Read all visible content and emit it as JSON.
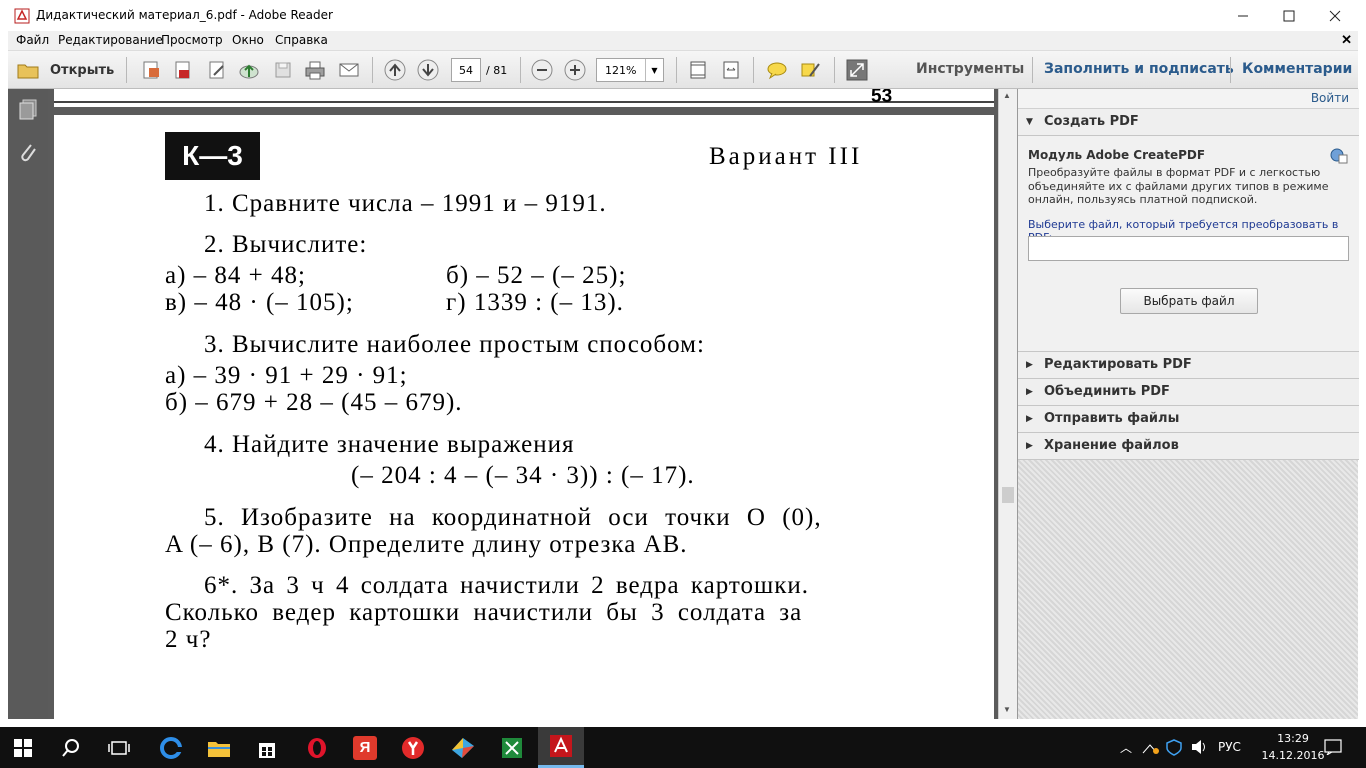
{
  "window": {
    "title": "Дидактический материал_6.pdf - Adobe Reader"
  },
  "menu": [
    "Файл",
    "Редактирование",
    "Просмотр",
    "Окно",
    "Справка"
  ],
  "toolbar": {
    "open": "Открыть",
    "page_current": "54",
    "page_total": "/ 81",
    "zoom": "121%",
    "tools": "Инструменты",
    "fill_sign": "Заполнить и подписать",
    "comments": "Комментарии"
  },
  "page": {
    "page_number": "53",
    "badge": "К—3",
    "variant": "Вариант III",
    "p1": "1. Сравните числа – 1991 и – 9191.",
    "p2": "2. Вычислите:",
    "p2a": "а)  – 84 + 48;",
    "p2b": "б)  – 52 – (– 25);",
    "p2c": "в)  – 48 · (– 105);",
    "p2d": "г)  1339 : (– 13).",
    "p3": "3. Вычислите наиболее простым способом:",
    "p3a": "а)  – 39 · 91 + 29 · 91;",
    "p3b": "б)  – 679 + 28 – (45 – 679).",
    "p4": "4. Найдите значение выражения",
    "p4e": "(– 204 : 4 – (– 34 · 3)) : (– 17).",
    "p5l1": "5. Изобразите на координатной оси точки O (0),",
    "p5l2": "A (– 6), B (7). Определите длину отрезка AB.",
    "p6l1": "6*. За 3 ч 4 солдата начистили 2 ведра картошки.",
    "p6l2": "Сколько ведер картошки начистили бы 3 солдата за",
    "p6l3": "2 ч?"
  },
  "rightpane": {
    "signin": "Войти",
    "create_pdf": "Создать PDF",
    "module_title": "Модуль Adobe CreatePDF",
    "module_desc": "Преобразуйте файлы в формат PDF и с легкостью объединяйте их с файлами других типов в режиме онлайн, пользуясь платной подпиской.",
    "select_label": "Выберите файл, который требуется преобразовать в PDF:",
    "choose_button": "Выбрать файл",
    "edit_pdf": "Редактировать PDF",
    "combine_pdf": "Объединить PDF",
    "send_files": "Отправить файлы",
    "store_files": "Хранение файлов"
  },
  "taskbar": {
    "lang": "РУС",
    "time": "13:29",
    "date": "14.12.2016"
  }
}
